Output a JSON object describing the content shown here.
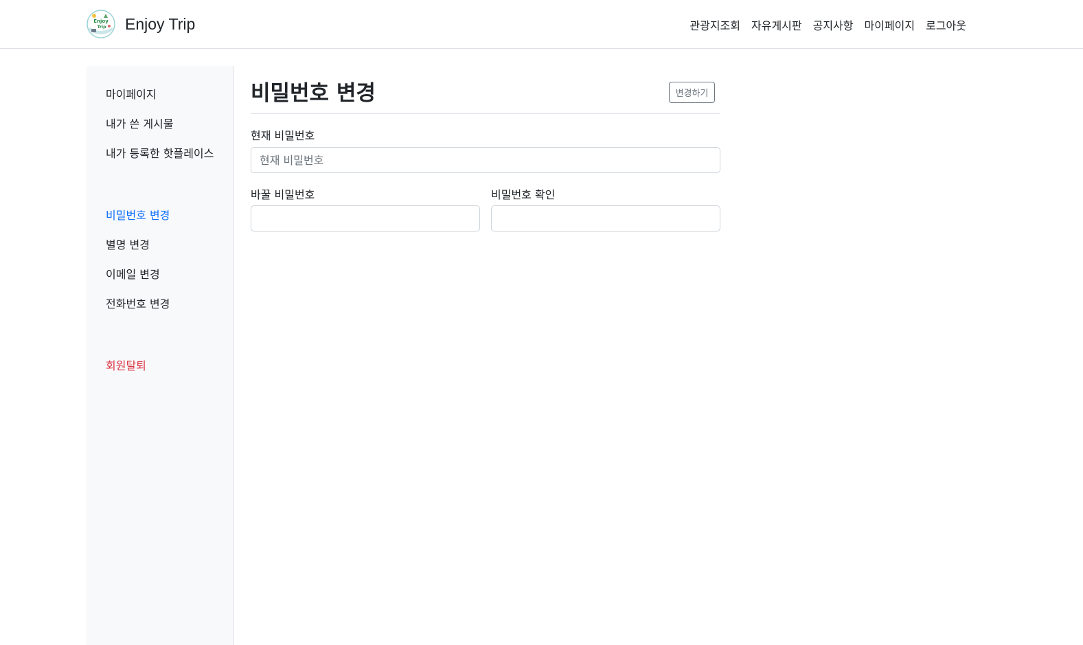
{
  "header": {
    "brand": "Enjoy Trip",
    "logo": {
      "text_top": "Enjoy",
      "text_bottom": "Trip"
    },
    "nav": [
      "관광지조회",
      "자유게시판",
      "공지사항",
      "마이페이지",
      "로그아웃"
    ]
  },
  "sidebar": {
    "group1": [
      "마이페이지",
      "내가 쓴 게시물",
      "내가 등록한 핫플레이스"
    ],
    "group2": [
      "비밀번호 변경",
      "별명 변경",
      "이메일 변경",
      "전화번호 변경"
    ],
    "withdraw": "회원탈퇴",
    "active_item": "비밀번호 변경"
  },
  "main": {
    "title": "비밀번호 변경",
    "change_button": "변경하기",
    "current_password": {
      "label": "현재 비밀번호",
      "placeholder": "현재 비밀번호",
      "value": ""
    },
    "new_password": {
      "label": "바꿀 비밀번호",
      "value": ""
    },
    "confirm_password": {
      "label": "비밀번호 확인",
      "value": ""
    }
  },
  "colors": {
    "active": "#0d6efd",
    "danger": "#dc3545",
    "sidebar_bg": "#f8f9fa",
    "border": "#dee2e6"
  }
}
